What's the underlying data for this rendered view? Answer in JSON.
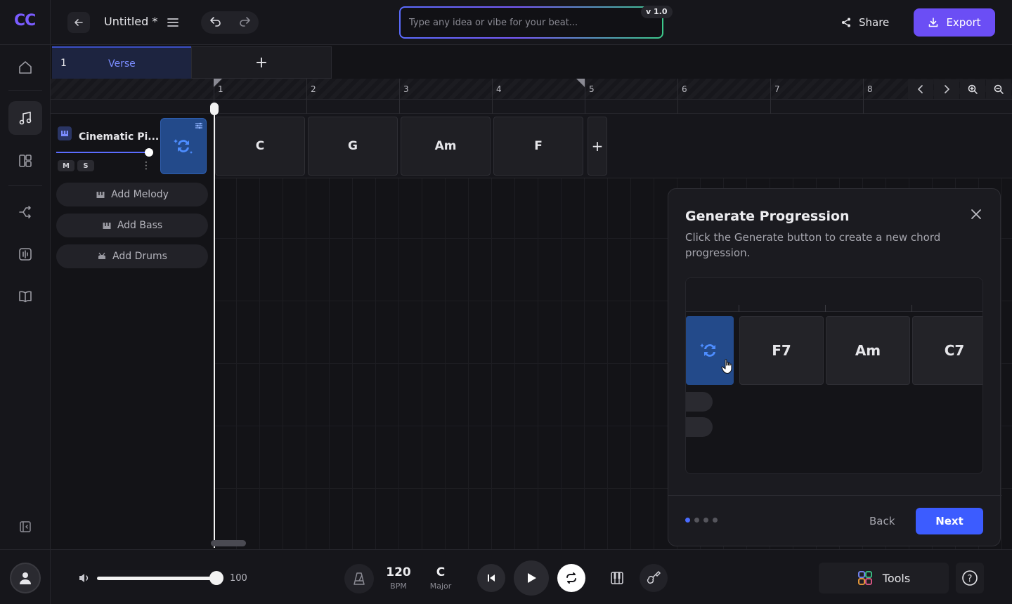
{
  "app": {
    "logo": "CC",
    "title": "Untitled *",
    "prompt_placeholder": "Type any idea or vibe for your beat...",
    "version": "v 1.0",
    "share_label": "Share",
    "export_label": "Export"
  },
  "nav": {
    "items": [
      {
        "name": "home",
        "icon": "home-icon"
      },
      {
        "name": "music",
        "icon": "music-note-icon",
        "active": true
      },
      {
        "name": "layout",
        "icon": "layout-icon"
      },
      {
        "name": "arrange",
        "icon": "shuffle-icon"
      },
      {
        "name": "mixer",
        "icon": "equalizer-icon"
      },
      {
        "name": "learn",
        "icon": "book-icon"
      }
    ]
  },
  "sections": {
    "tabs": [
      {
        "number": "1",
        "name": "Verse"
      }
    ],
    "add_label": "+"
  },
  "ruler": {
    "bars": [
      "1",
      "2",
      "3",
      "4",
      "5",
      "6",
      "7",
      "8"
    ]
  },
  "track": {
    "name": "Cinematic Pi...",
    "mute": "M",
    "solo": "S",
    "more": "⋮",
    "add_buttons": [
      {
        "label": "Add Melody"
      },
      {
        "label": "Add Bass"
      },
      {
        "label": "Add Drums"
      }
    ]
  },
  "chords": {
    "items": [
      "C",
      "G",
      "Am",
      "F"
    ],
    "add_label": "+"
  },
  "popup": {
    "title": "Generate Progression",
    "description": "Click the Generate button to create a new chord progression.",
    "demo_chords": [
      "F7",
      "Am",
      "C7"
    ],
    "step": 1,
    "steps_total": 4,
    "back_label": "Back",
    "next_label": "Next"
  },
  "transport": {
    "volume": "100",
    "volume_level": 1.0,
    "bpm": "120",
    "bpm_label": "BPM",
    "key": "C",
    "mode": "Major",
    "tools_label": "Tools",
    "help": "?"
  },
  "colors": {
    "accent": "#6b4ef5",
    "primary_blue": "#3c5cff",
    "generate_tile": "#234a8a"
  }
}
